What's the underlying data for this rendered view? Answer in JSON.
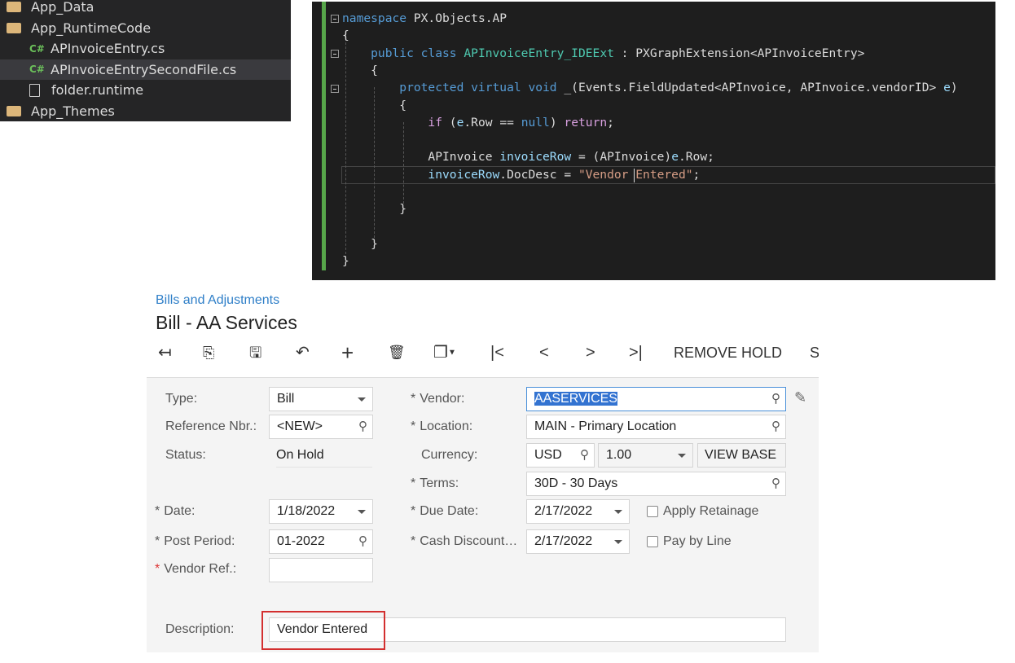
{
  "explorer": {
    "items": [
      {
        "label": "App_Data",
        "icon": "folder-icon"
      },
      {
        "label": "App_RuntimeCode",
        "icon": "folder-open-icon"
      },
      {
        "label": "APInvoiceEntry.cs",
        "icon": "csharp-file-icon"
      },
      {
        "label": "APInvoiceEntrySecondFile.cs",
        "icon": "csharp-file-icon",
        "selected": true
      },
      {
        "label": "folder.runtime",
        "icon": "file-icon"
      },
      {
        "label": "App_Themes",
        "icon": "folder-icon"
      }
    ],
    "cs_badge": "C#"
  },
  "code": {
    "lines": [
      [
        {
          "t": "namespace",
          "k": "kw"
        },
        {
          "t": " PX.Objects.AP",
          "k": "tx"
        }
      ],
      [
        {
          "t": "{",
          "k": "tx"
        }
      ],
      [
        {
          "t": "    public class",
          "k": "kw"
        },
        {
          "t": " APInvoiceEntry_IDEExt",
          "k": "ty"
        },
        {
          "t": " : PXGraphExtension<APInvoiceEntry>",
          "k": "tx"
        }
      ],
      [
        {
          "t": "    {",
          "k": "tx"
        }
      ],
      [
        {
          "t": "        protected virtual void",
          "k": "kw"
        },
        {
          "t": " _(Events.FieldUpdated<APInvoice, APInvoice.vendorID> ",
          "k": "tx"
        },
        {
          "t": "e",
          "k": "id"
        },
        {
          "t": ")",
          "k": "tx"
        }
      ],
      [
        {
          "t": "        {",
          "k": "tx"
        }
      ],
      [
        {
          "t": "            if",
          "k": "ctl"
        },
        {
          "t": " (",
          "k": "tx"
        },
        {
          "t": "e",
          "k": "id"
        },
        {
          "t": ".Row == ",
          "k": "tx"
        },
        {
          "t": "null",
          "k": "kw"
        },
        {
          "t": ") ",
          "k": "tx"
        },
        {
          "t": "return",
          "k": "ctl"
        },
        {
          "t": ";",
          "k": "tx"
        }
      ],
      [],
      [
        {
          "t": "            APInvoice ",
          "k": "tx"
        },
        {
          "t": "invoiceRow",
          "k": "id"
        },
        {
          "t": " = (APInvoice)",
          "k": "tx"
        },
        {
          "t": "e",
          "k": "id"
        },
        {
          "t": ".Row;",
          "k": "tx"
        }
      ],
      [
        {
          "t": "            invoiceRow",
          "k": "id"
        },
        {
          "t": ".DocDesc = ",
          "k": "tx"
        },
        {
          "t": "\"Vendor Entered\"",
          "k": "st"
        },
        {
          "t": ";",
          "k": "tx"
        }
      ],
      [],
      [
        {
          "t": "        }",
          "k": "tx"
        }
      ],
      [],
      [
        {
          "t": "    }",
          "k": "tx"
        }
      ],
      [
        {
          "t": "}",
          "k": "tx"
        }
      ]
    ]
  },
  "page": {
    "breadcrumb": "Bills and Adjustments",
    "title": "Bill - AA Services"
  },
  "toolbar": {
    "back": "↤",
    "save_close": "⎘",
    "save": "🖫",
    "undo": "↶",
    "add": "+",
    "delete": "🗑",
    "copy": "❐",
    "first": "|<",
    "prev": "<",
    "next": ">",
    "last": ">|",
    "remove_hold": "REMOVE HOLD",
    "more": "S"
  },
  "form": {
    "type": {
      "label": "Type:",
      "value": "Bill"
    },
    "ref": {
      "label": "Reference Nbr.:",
      "value": "<NEW>"
    },
    "status": {
      "label": "Status:",
      "value": "On Hold"
    },
    "date": {
      "label": "Date:",
      "value": "1/18/2022"
    },
    "post_period": {
      "label": "Post Period:",
      "value": "01-2022"
    },
    "vendor_ref": {
      "label": "Vendor Ref.:",
      "value": ""
    },
    "vendor": {
      "label": "Vendor:",
      "value": "AASERVICES"
    },
    "location": {
      "label": "Location:",
      "value": "MAIN - Primary Location"
    },
    "currency": {
      "label": "Currency:",
      "value": "USD",
      "rate": "1.00",
      "view_base": "VIEW BASE"
    },
    "terms": {
      "label": "Terms:",
      "value": "30D - 30 Days"
    },
    "due_date": {
      "label": "Due Date:",
      "value": "2/17/2022"
    },
    "cash_discount": {
      "label": "Cash Discount…",
      "value": "2/17/2022"
    },
    "apply_retainage": {
      "label": "Apply Retainage",
      "checked": false
    },
    "pay_by_line": {
      "label": "Pay by Line",
      "checked": false
    },
    "description": {
      "label": "Description:",
      "value": "Vendor Entered"
    },
    "required_mark": "*"
  }
}
